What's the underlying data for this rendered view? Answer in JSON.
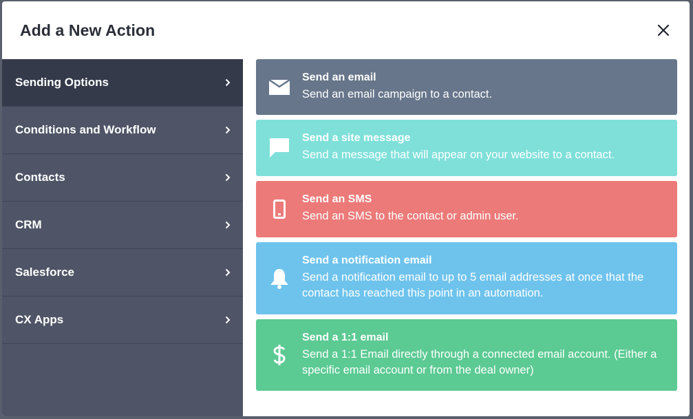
{
  "modal": {
    "title": "Add a New Action",
    "close_icon": "close-icon"
  },
  "sidebar": {
    "items": [
      {
        "label": "Sending Options",
        "active": true
      },
      {
        "label": "Conditions and Workflow",
        "active": false
      },
      {
        "label": "Contacts",
        "active": false
      },
      {
        "label": "CRM",
        "active": false
      },
      {
        "label": "Salesforce",
        "active": false
      },
      {
        "label": "CX Apps",
        "active": false
      }
    ]
  },
  "actions": [
    {
      "title": "Send an email",
      "desc": "Send an email campaign to a contact.",
      "icon": "envelope-icon",
      "color": "#67768b"
    },
    {
      "title": "Send a site message",
      "desc": "Send a message that will appear on your website to a contact.",
      "icon": "chat-bubble-icon",
      "color": "#7fe0da"
    },
    {
      "title": "Send an SMS",
      "desc": "Send an SMS to the contact or admin user.",
      "icon": "mobile-phone-icon",
      "color": "#ec7a79"
    },
    {
      "title": "Send a notification email",
      "desc": "Send a notification email to up to 5 email addresses at once that the contact has reached this point in an automation.",
      "icon": "bell-icon",
      "color": "#6ec3ed"
    },
    {
      "title": "Send a 1:1 email",
      "desc": "Send a 1:1 Email directly through a connected email account. (Either a specific email account or from the deal owner)",
      "icon": "dollar-icon",
      "color": "#5bca93"
    }
  ]
}
